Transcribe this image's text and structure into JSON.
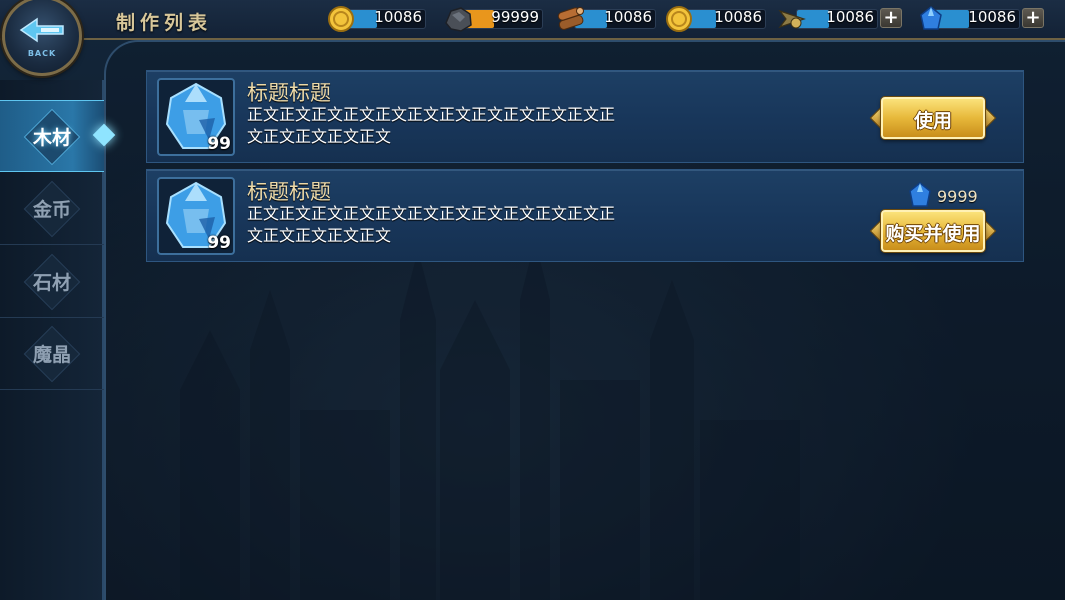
{
  "header": {
    "back_label": "BACK",
    "title": "制作列表"
  },
  "resources": [
    {
      "icon": "gold-coin-icon",
      "value": "10086",
      "fill_color": "#2a8fd0"
    },
    {
      "icon": "iron-ore-icon",
      "value": "99999",
      "fill_color": "#e9961c"
    },
    {
      "icon": "wood-log-icon",
      "value": "10086",
      "fill_color": "#2a8fd0"
    },
    {
      "icon": "gold-coin-icon",
      "value": "10086",
      "fill_color": "#2a8fd0"
    },
    {
      "icon": "crossbow-arrow-icon",
      "value": "10086",
      "fill_color": "#2a8fd0"
    },
    {
      "icon": "blue-crystal-icon",
      "value": "10086",
      "fill_color": "#2a8fd0"
    }
  ],
  "sidebar": {
    "tabs": [
      {
        "label": "木材",
        "active": true
      },
      {
        "label": "金币",
        "active": false
      },
      {
        "label": "石材",
        "active": false
      },
      {
        "label": "魔晶",
        "active": false
      }
    ]
  },
  "items": [
    {
      "title": "标题标题",
      "description": "正文正文正文正文正文正文正文正文正文正文正文正文正文正文正文正文",
      "count": "99",
      "button_label": "使用",
      "price": null
    },
    {
      "title": "标题标题",
      "description": "正文正文正文正文正文正文正文正文正文正文正文正文正文正文正文正文",
      "count": "99",
      "button_label": "购买并使用",
      "price": "9999"
    }
  ],
  "colors": {
    "accent_gold": "#e7b83a",
    "accent_blue": "#2a8fd0",
    "title_text": "#ecd9a8"
  }
}
